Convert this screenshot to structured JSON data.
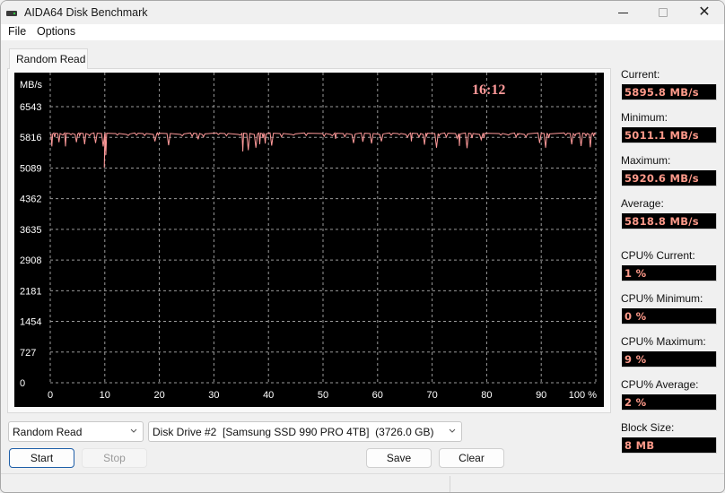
{
  "window": {
    "title": "AIDA64 Disk Benchmark",
    "app_icon": "disk-drive-icon",
    "controls": [
      "minimize-icon",
      "maximize-icon",
      "close-icon"
    ]
  },
  "menu": {
    "items": [
      {
        "label": "File"
      },
      {
        "label": "Options"
      }
    ]
  },
  "tabs": [
    {
      "label": "Random Read",
      "active": true
    }
  ],
  "chart_data": {
    "type": "line",
    "title": "",
    "overlay_time": "16:12",
    "ylabel": "MB/s",
    "xlabel": "%",
    "ylim": [
      0,
      6543
    ],
    "xlim": [
      0,
      100
    ],
    "y_ticks": [
      "0",
      "727",
      "1454",
      "2181",
      "2908",
      "3635",
      "4362",
      "5089",
      "5816",
      "6543"
    ],
    "x_ticks": [
      "0",
      "10",
      "20",
      "30",
      "40",
      "50",
      "60",
      "70",
      "80",
      "90",
      "100 %"
    ],
    "grid": true,
    "line_color": "#ff9a9a",
    "series": [
      {
        "name": "Random Read",
        "x_range": [
          0,
          100
        ],
        "baseline": 5910,
        "dips": [
          [
            0.3,
            5600
          ],
          [
            0.8,
            5820
          ],
          [
            1.6,
            5700
          ],
          [
            2.3,
            5870
          ],
          [
            2.8,
            5600
          ],
          [
            3.8,
            5880
          ],
          [
            4.8,
            5700
          ],
          [
            5.4,
            5850
          ],
          [
            6.3,
            5650
          ],
          [
            7.2,
            5850
          ],
          [
            8.3,
            5680
          ],
          [
            9.7,
            5600
          ],
          [
            9.9,
            5100
          ],
          [
            10.2,
            5400
          ],
          [
            12.3,
            5870
          ],
          [
            14.3,
            5860
          ],
          [
            15.8,
            5870
          ],
          [
            17.3,
            5860
          ],
          [
            19.2,
            5720
          ],
          [
            19.8,
            5870
          ],
          [
            21.7,
            5630
          ],
          [
            24.2,
            5850
          ],
          [
            26.0,
            5840
          ],
          [
            27.1,
            5770
          ],
          [
            28.1,
            5830
          ],
          [
            30.8,
            5880
          ],
          [
            32.3,
            5850
          ],
          [
            34.8,
            5870
          ],
          [
            35.3,
            5480
          ],
          [
            36.3,
            5510
          ],
          [
            37.7,
            5570
          ],
          [
            38.4,
            5650
          ],
          [
            39.0,
            5800
          ],
          [
            39.4,
            5670
          ],
          [
            40.6,
            5620
          ],
          [
            42.4,
            5830
          ],
          [
            44.6,
            5870
          ],
          [
            46.9,
            5860
          ],
          [
            50.2,
            5840
          ],
          [
            51.7,
            5850
          ],
          [
            52.3,
            5780
          ],
          [
            54.0,
            5830
          ],
          [
            55.6,
            5680
          ],
          [
            57.3,
            5710
          ],
          [
            58.9,
            5670
          ],
          [
            60.7,
            5720
          ],
          [
            62.5,
            5870
          ],
          [
            64.0,
            5880
          ],
          [
            65.5,
            5820
          ],
          [
            66.2,
            5720
          ],
          [
            67.6,
            5820
          ],
          [
            68.6,
            5640
          ],
          [
            69.0,
            5850
          ],
          [
            70.8,
            5570
          ],
          [
            71.3,
            5850
          ],
          [
            72.6,
            5820
          ],
          [
            74.6,
            5790
          ],
          [
            75.0,
            5610
          ],
          [
            76.4,
            5560
          ],
          [
            77.3,
            5800
          ],
          [
            79.0,
            5760
          ],
          [
            79.5,
            5800
          ],
          [
            82.6,
            5870
          ],
          [
            84.0,
            5870
          ],
          [
            85.4,
            5820
          ],
          [
            85.8,
            5880
          ],
          [
            87.2,
            5820
          ],
          [
            89.7,
            5680
          ],
          [
            90.8,
            5570
          ],
          [
            91.4,
            5800
          ],
          [
            94.5,
            5870
          ],
          [
            95.6,
            5650
          ],
          [
            96.2,
            5850
          ],
          [
            97.3,
            5610
          ],
          [
            98.2,
            5850
          ],
          [
            99.0,
            5580
          ],
          [
            99.6,
            5840
          ]
        ]
      }
    ]
  },
  "stats": {
    "current": {
      "label": "Current:",
      "value": "5895.8 MB/s"
    },
    "minimum": {
      "label": "Minimum:",
      "value": "5011.1 MB/s"
    },
    "maximum": {
      "label": "Maximum:",
      "value": "5920.6 MB/s"
    },
    "average": {
      "label": "Average:",
      "value": "5818.8 MB/s"
    },
    "cpu_current": {
      "label": "CPU% Current:",
      "value": "1 %"
    },
    "cpu_minimum": {
      "label": "CPU% Minimum:",
      "value": "0 %"
    },
    "cpu_maximum": {
      "label": "CPU% Maximum:",
      "value": "9 %"
    },
    "cpu_average": {
      "label": "CPU% Average:",
      "value": "2 %"
    },
    "block_size": {
      "label": "Block Size:",
      "value": "8 MB"
    }
  },
  "controls": {
    "mode_select": {
      "value": "Random Read"
    },
    "drive_select": {
      "value": "Disk Drive #2  [Samsung SSD 990 PRO 4TB]  (3726.0 GB)"
    },
    "start_label": "Start",
    "stop_label": "Stop",
    "save_label": "Save",
    "clear_label": "Clear"
  }
}
